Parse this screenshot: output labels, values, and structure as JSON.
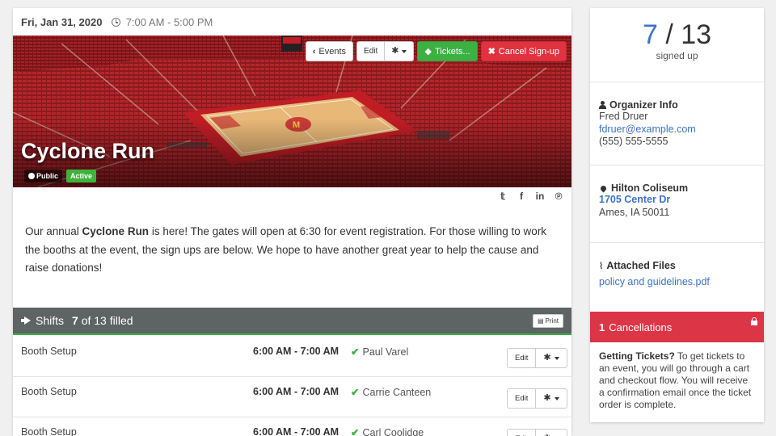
{
  "event": {
    "date": "Fri, Jan 31, 2020",
    "time": "7:00 AM - 5:00 PM",
    "title": "Cyclone Run",
    "badge_public": "Public",
    "badge_active": "Active"
  },
  "actions": {
    "events_label": "Events",
    "edit_label": "Edit",
    "tickets_label": "Tickets...",
    "cancel_label": "Cancel Sign-up"
  },
  "social": {
    "icons": [
      "twitter-icon",
      "facebook-icon",
      "linkedin-icon",
      "pinterest-icon"
    ],
    "glyphs": [
      "𝕥",
      "f",
      "in",
      "℗"
    ]
  },
  "description": {
    "part1": "Our annual ",
    "bold": "Cyclone Run",
    "part2": " is here!  The gates will open at 6:30 for event registration.  For those willing to work the booths at the event, the sign ups are below.  We hope to have another great year to help the cause and raise donations!"
  },
  "shifts": {
    "label": "Shifts",
    "filled_count": "7",
    "filled_rest": "of 13 filled",
    "print_label": "Print",
    "rows": [
      {
        "name": "Booth Setup",
        "time": "6:00 AM - 7:00 AM",
        "volunteer": "Paul Varel",
        "edit": "Edit"
      },
      {
        "name": "Booth Setup",
        "time": "6:00 AM - 7:00 AM",
        "volunteer": "Carrie Canteen",
        "edit": "Edit"
      },
      {
        "name": "Booth Setup",
        "time": "6:00 AM - 7:00 AM",
        "volunteer": "Carl Coolidge",
        "edit": "Edit"
      }
    ]
  },
  "signup": {
    "current": "7",
    "separator": " / ",
    "total": "13",
    "label": "signed up"
  },
  "organizer": {
    "title": "Organizer Info",
    "name": "Fred Druer",
    "email": "fdruer@example.com",
    "phone": "(555) 555-5555"
  },
  "location": {
    "title": "Hilton Coliseum",
    "address": "1705 Center Dr",
    "city": "Ames, IA 50011"
  },
  "files": {
    "title": "Attached Files",
    "file": "policy and guidelines.pdf"
  },
  "cancellations": {
    "count": "1",
    "label": "Cancellations"
  },
  "tickets_info": {
    "bold": "Getting Tickets?",
    "text": " To get tickets to an event, you will go through a cart and checkout flow. You will receive a confirmation email once the ticket order is complete."
  },
  "colors": {
    "accent_blue": "#3b73c8",
    "green": "#3cb043",
    "red": "#dc3545",
    "shifts_header": "#5e6364"
  }
}
